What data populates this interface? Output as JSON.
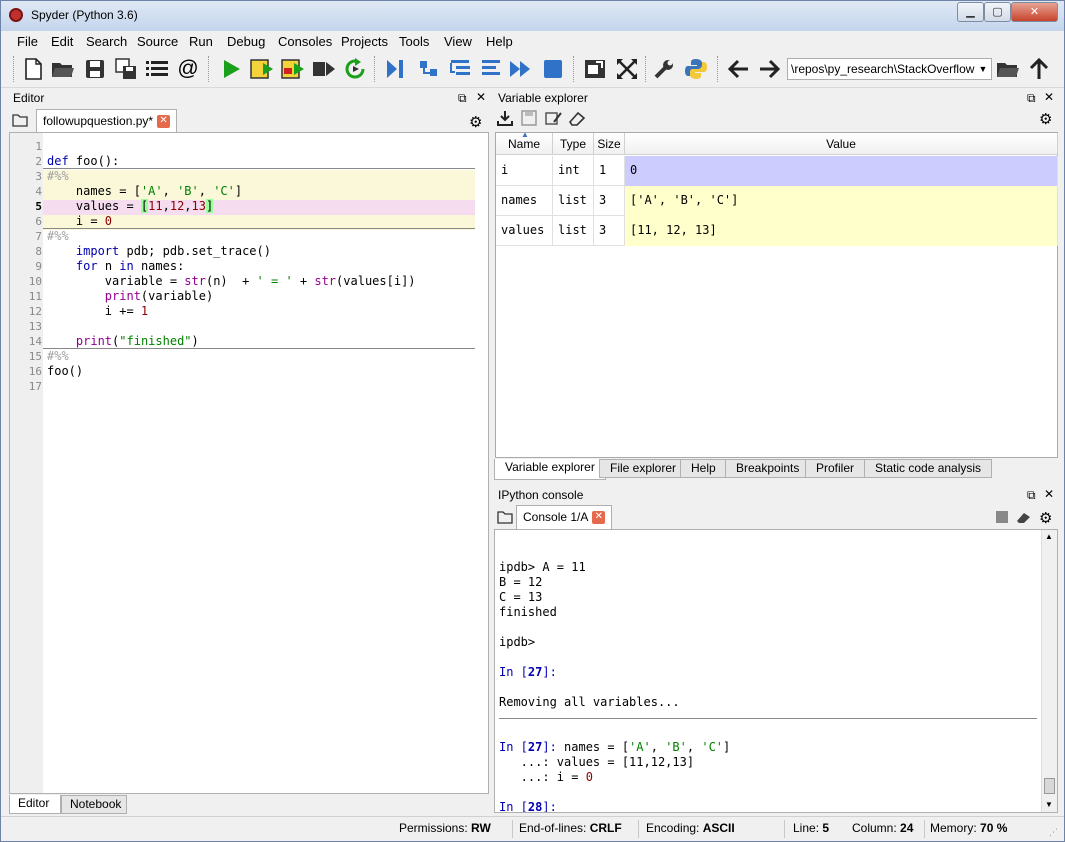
{
  "window": {
    "title": "Spyder (Python 3.6)",
    "min_glyph": "▁",
    "max_glyph": "▢",
    "close_glyph": "✕"
  },
  "menu": [
    "File",
    "Edit",
    "Search",
    "Source",
    "Run",
    "Debug",
    "Consoles",
    "Projects",
    "Tools",
    "View",
    "Help"
  ],
  "toolbar": {
    "path": "\\repos\\py_research\\StackOverflow"
  },
  "editor": {
    "title": "Editor",
    "tab": {
      "label": "followupquestion.py*",
      "close": "✕"
    },
    "line_numbers": [
      "1",
      "2",
      "3",
      "4",
      "5",
      "6",
      "7",
      "8",
      "9",
      "10",
      "11",
      "12",
      "13",
      "14",
      "15",
      "16",
      "17"
    ],
    "current_line": 5,
    "bottom_tabs": [
      "Editor",
      "Notebook"
    ]
  },
  "variable_explorer": {
    "title": "Variable explorer",
    "columns": [
      "Name",
      "Type",
      "Size",
      "Value"
    ],
    "rows": [
      {
        "name": "i",
        "type": "int",
        "size": "1",
        "value": "0",
        "color": "#ccccff"
      },
      {
        "name": "names",
        "type": "list",
        "size": "3",
        "value": "['A', 'B', 'C']",
        "color": "#ffffcc"
      },
      {
        "name": "values",
        "type": "list",
        "size": "3",
        "value": "[11, 12, 13]",
        "color": "#ffffcc"
      }
    ],
    "tabs": [
      "Variable explorer",
      "File explorer",
      "Help",
      "Breakpoints",
      "Profiler",
      "Static code analysis"
    ]
  },
  "console": {
    "title": "IPython console",
    "tab": {
      "label": "Console 1/A",
      "close": "✕"
    },
    "lines": {
      "l1": "ipdb> A = 11",
      "l2": "B = 12",
      "l3": "C = 13",
      "l4": "finished",
      "l5": "ipdb>",
      "l6_prompt": "In [",
      "l6_num": "27",
      "l6_end": "]:",
      "l7": "Removing all variables...",
      "l8_prompt": "In [",
      "l8_num": "27",
      "l8_end": "]:",
      "l8_code_a": " names = [",
      "l8_code_b": "'A'",
      "l8_code_c": ", ",
      "l8_code_d": "'B'",
      "l8_code_e": ", ",
      "l8_code_f": "'C'",
      "l8_code_g": "]",
      "l9": "   ...: values = [11,12,13]",
      "l10_a": "   ...: i = ",
      "l10_b": "0",
      "l11_prompt": "In [",
      "l11_num": "28",
      "l11_end": "]:"
    }
  },
  "status": {
    "permissions_label": "Permissions:",
    "permissions": "RW",
    "eol_label": "End-of-lines:",
    "eol": "CRLF",
    "encoding_label": "Encoding:",
    "encoding": "ASCII",
    "line_label": "Line:",
    "line": "5",
    "column_label": "Column:",
    "column": "24",
    "memory_label": "Memory:",
    "memory": "70 %"
  },
  "colors": {
    "accent": "#3b6fc0",
    "cell_bg": "#fbf7d9",
    "current_line": "#f6dcef",
    "matched_bracket": "#99ff99"
  }
}
